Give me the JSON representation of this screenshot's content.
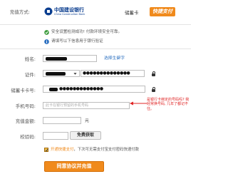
{
  "pay_method": {
    "label": "充值方式:",
    "bank_name_cn": "中国建设银行",
    "bank_name_en": "China Construction Bank",
    "card_type": "储蓄卡",
    "brand": "快捷支付"
  },
  "notices": {
    "safe_env": "安全设置检测成功! 付款环境安全可靠。",
    "verify_info": "请填写以下信息用于银行验证"
  },
  "form": {
    "name_label": "姓名:",
    "select_rare_char": "选择生僻字",
    "id_label": "证件:",
    "card_label": "储蓄卡卡号:",
    "phone_label": "手机号码:",
    "phone_placeholder": "此卡在银行预留的手机号码",
    "amount_label": "充值金额:",
    "amount_unit": "元",
    "code_label": "校验码:",
    "get_code_button": "免费获取"
  },
  "tip": {
    "text": "是银行卡绑定的号码吗? 我经常换号码, 几年了都记不住。"
  },
  "agreement": {
    "checked": true,
    "text_accent": "开通快捷支付",
    "text_rest": "，下次可无需支付宝支付密码快速付款"
  },
  "submit": {
    "label": "同意协议并充值"
  },
  "colors": {
    "brand_orange": "#f08a1c",
    "link_blue": "#2a6fc0",
    "tip_red": "#e02424",
    "ok_green": "#3a9a3a",
    "ccb_blue": "#0a3d8f"
  }
}
